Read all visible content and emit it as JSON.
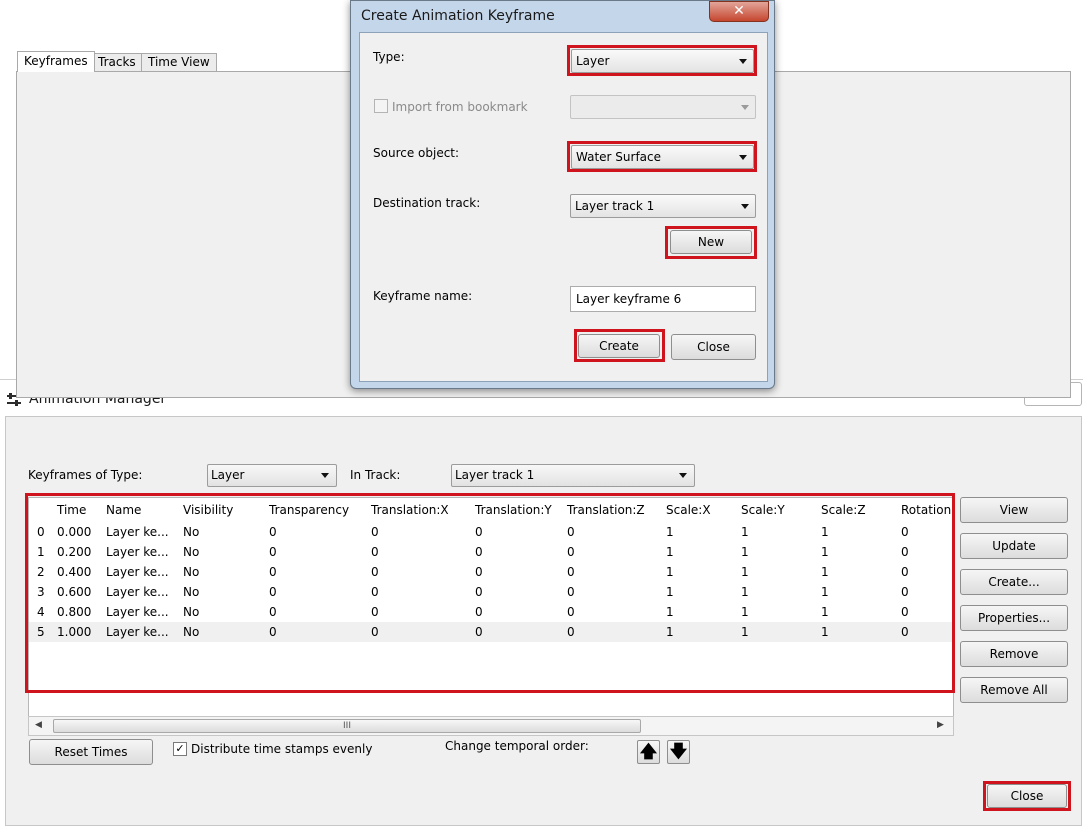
{
  "dialog": {
    "title": "Create Animation Keyframe",
    "close_glyph": "✕",
    "type_label": "Type:",
    "type_value": "Layer",
    "import_label": "Import from bookmark",
    "import_checked": false,
    "bookmark_value": "",
    "source_label": "Source object:",
    "source_value": "Water Surface",
    "dest_label": "Destination track:",
    "dest_value": "Layer track 1",
    "new_button": "New",
    "name_label": "Keyframe name:",
    "name_value": "Layer keyframe 6",
    "create_button": "Create",
    "close_button": "Close"
  },
  "manager": {
    "title": "Animation Manager",
    "close_glyph": "✕",
    "tabs": [
      "Keyframes",
      "Tracks",
      "Time View"
    ],
    "active_tab": "Keyframes",
    "type_label": "Keyframes of Type:",
    "type_value": "Layer",
    "track_label": "In Track:",
    "track_value": "Layer track 1",
    "columns": [
      "",
      "Time",
      "Name",
      "Visibility",
      "Transparency",
      "Translation:X",
      "Translation:Y",
      "Translation:Z",
      "Scale:X",
      "Scale:Y",
      "Scale:Z",
      "Rotation"
    ],
    "rows": [
      [
        "0",
        "0.000",
        "Layer ke...",
        "No",
        "0",
        "0",
        "0",
        "0",
        "1",
        "1",
        "1",
        "0"
      ],
      [
        "1",
        "0.200",
        "Layer ke...",
        "No",
        "0",
        "0",
        "0",
        "0",
        "1",
        "1",
        "1",
        "0"
      ],
      [
        "2",
        "0.400",
        "Layer ke...",
        "No",
        "0",
        "0",
        "0",
        "0",
        "1",
        "1",
        "1",
        "0"
      ],
      [
        "3",
        "0.600",
        "Layer ke...",
        "No",
        "0",
        "0",
        "0",
        "0",
        "1",
        "1",
        "1",
        "0"
      ],
      [
        "4",
        "0.800",
        "Layer ke...",
        "No",
        "0",
        "0",
        "0",
        "0",
        "1",
        "1",
        "1",
        "0"
      ],
      [
        "5",
        "1.000",
        "Layer ke...",
        "No",
        "0",
        "0",
        "0",
        "0",
        "1",
        "1",
        "1",
        "0"
      ]
    ],
    "selected_row": 5,
    "side_buttons": [
      "View",
      "Update",
      "Create...",
      "Properties...",
      "Remove",
      "Remove All"
    ],
    "reset_button": "Reset Times",
    "distribute_label": "Distribute time stamps evenly",
    "distribute_checked": true,
    "temporal_label": "Change temporal order:",
    "up_glyph": "🡅",
    "down_glyph": "🡇",
    "close_button": "Close",
    "scroll_thumb_glyph": "III",
    "scroll_left_glyph": "◀",
    "scroll_right_glyph": "▶"
  },
  "colors": {
    "highlight": "#d0141e",
    "dialog_frame": "#c4d6ea",
    "panel": "#f0f0f0",
    "selected_row": "#f0f0f0"
  }
}
